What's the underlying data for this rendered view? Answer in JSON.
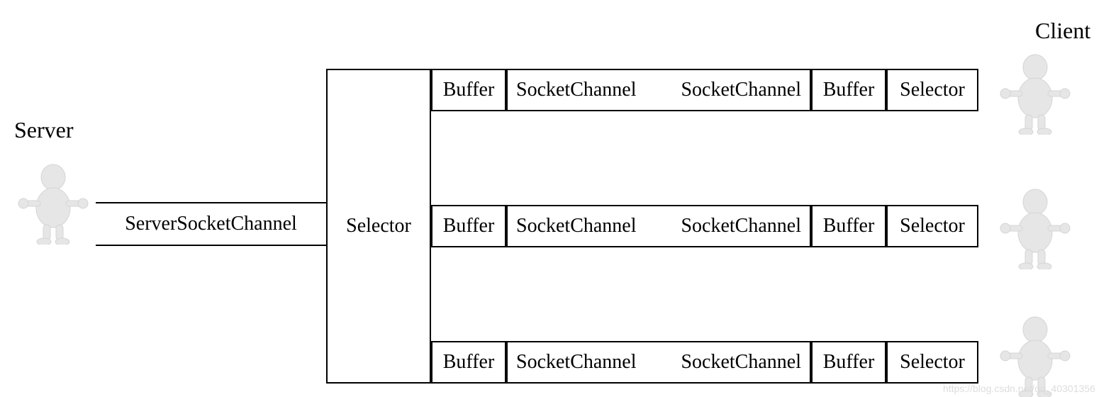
{
  "labels": {
    "server": "Server",
    "client": "Client",
    "serverSocketChannel": "ServerSocketChannel",
    "selector": "Selector",
    "buffer": "Buffer",
    "socketChannel": "SocketChannel"
  },
  "watermark": "https://blog.csdn.net/qq_40301356"
}
